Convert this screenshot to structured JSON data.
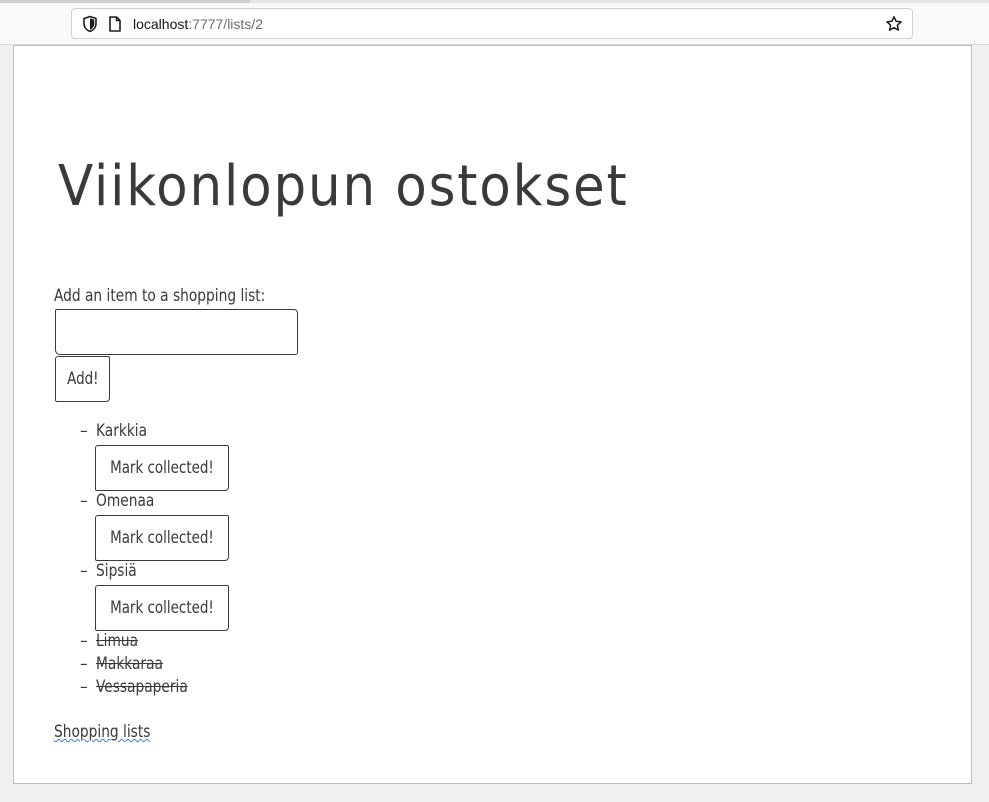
{
  "browser": {
    "url_host": "localhost",
    "url_rest": ":7777/lists/2"
  },
  "page": {
    "title": "Viikonlopun ostokset",
    "form_label": "Add an item to a shopping list:",
    "input_value": "",
    "add_button_label": "Add!",
    "items": [
      {
        "name": "Karkkia",
        "collected": false,
        "action_label": "Mark collected!"
      },
      {
        "name": "Omenaa",
        "collected": false,
        "action_label": "Mark collected!"
      },
      {
        "name": "Sipsiä",
        "collected": false,
        "action_label": "Mark collected!"
      },
      {
        "name": "Limua",
        "collected": true
      },
      {
        "name": "Makkaraa",
        "collected": true
      },
      {
        "name": "Vessapaperia",
        "collected": true
      }
    ],
    "dash": "–",
    "footer_link": "Shopping lists"
  }
}
